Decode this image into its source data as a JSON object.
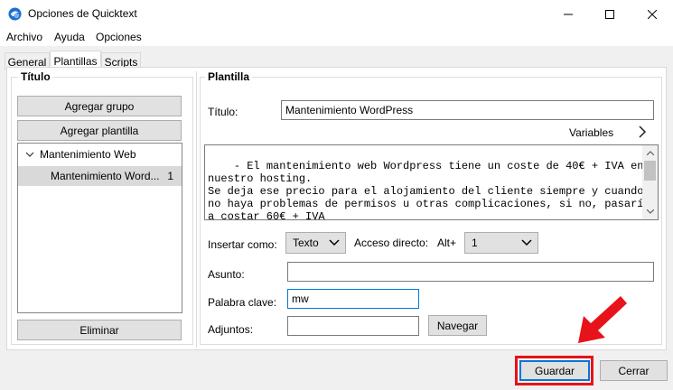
{
  "window": {
    "title": "Opciones de Quicktext",
    "icon": "thunderbird-icon",
    "controls": [
      "minimize-icon",
      "maximize-icon",
      "close-icon"
    ]
  },
  "menu": [
    "Archivo",
    "Ayuda",
    "Opciones"
  ],
  "tabs": [
    {
      "label": "General",
      "active": false
    },
    {
      "label": "Plantillas",
      "active": true
    },
    {
      "label": "Scripts",
      "active": false
    }
  ],
  "left_panel": {
    "title": "Título",
    "add_group": "Agregar grupo",
    "add_template": "Agregar plantilla",
    "tree": {
      "group": "Mantenimiento Web",
      "item": "Mantenimiento Word...",
      "item_shortcut": "1"
    },
    "delete": "Eliminar"
  },
  "right_panel": {
    "title": "Plantilla",
    "title_label": "Título:",
    "title_value": "Mantenimiento WordPress",
    "variables_label": "Variables",
    "body_text": "- El mantenimiento web Wordpress tiene un coste de 40€ + IVA en\nnuestro hosting.\nSe deja ese precio para el alojamiento del cliente siempre y cuando\nno haya problemas de permisos u otras complicaciones, si no, pasaría\na costar 60€ + IVA",
    "insert_as_label": "Insertar como:",
    "insert_as_value": "Texto",
    "shortcut_label": "Acceso directo:",
    "shortcut_prefix": "Alt+",
    "shortcut_value": "1",
    "subject_label": "Asunto:",
    "subject_value": "",
    "keyword_label": "Palabra clave:",
    "keyword_value": "mw",
    "attachments_label": "Adjuntos:",
    "attachments_value": "",
    "browse": "Navegar"
  },
  "footer": {
    "save": "Guardar",
    "close": "Cerrar"
  },
  "colors": {
    "highlight": "#e8121a",
    "focus_border": "#0078d7"
  }
}
